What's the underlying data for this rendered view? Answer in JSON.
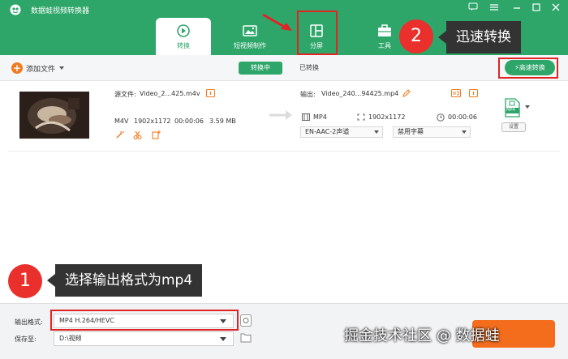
{
  "window": {
    "title": "数据蛙视频转换器"
  },
  "tabs": [
    {
      "label": "转换"
    },
    {
      "label": "短视频制作"
    },
    {
      "label": "分屏"
    },
    {
      "label": "工具"
    }
  ],
  "toolbar": {
    "add_file": "添加文件",
    "converting": "转换中",
    "converted": "已转换",
    "fast_convert": "高速转换"
  },
  "file": {
    "source_label": "源文件:",
    "source_name": "Video_2...425.m4v",
    "src_format": "M4V",
    "src_resolution": "1902x1172",
    "src_duration": "00:00:06",
    "src_size": "3.59 MB",
    "output_label": "输出:",
    "output_name": "Video_240...94425.mp4",
    "out_format": "MP4",
    "out_resolution": "1902x1172",
    "out_duration": "00:00:06",
    "audio_track": "EN-AAC-2声道",
    "subtitle": "禁用字幕",
    "format_badge": "MP4",
    "settings": "设置"
  },
  "bottom": {
    "format_label": "输出格式:",
    "format_value": "MP4 H.264/HEVC",
    "save_label": "保存至:",
    "save_path": "D:\\视频"
  },
  "annotations": {
    "step1_number": "1",
    "step1_text": "选择输出格式为mp4",
    "step2_number": "2",
    "step2_text": "迅速转换"
  },
  "watermark": "掘金技术社区 @ 数据蛙",
  "colors": {
    "brand_green": "#2ea66a",
    "accent_orange": "#f46d1d",
    "annotation_red": "#e02424"
  }
}
